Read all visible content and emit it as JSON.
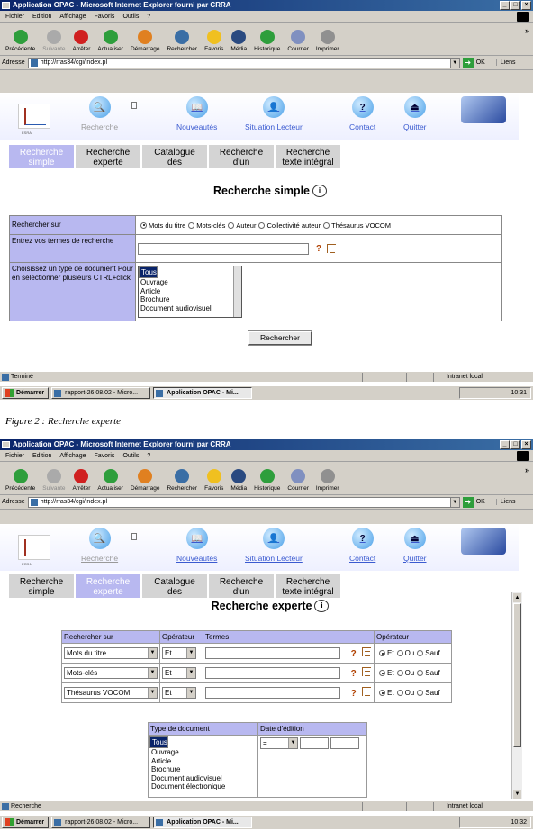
{
  "window": {
    "title": "Application OPAC - Microsoft Internet Explorer fourni par CRRA",
    "menu": [
      "Fichier",
      "Edition",
      "Affichage",
      "Favoris",
      "Outils",
      "?"
    ],
    "toolbar": [
      {
        "label": "Précédente",
        "icon": "back-icon",
        "color": "#2e9e3c"
      },
      {
        "label": "Suivante",
        "icon": "forward-icon",
        "color": "#aaaaaa"
      },
      {
        "label": "Arrêter",
        "icon": "stop-icon",
        "color": "#d02020"
      },
      {
        "label": "Actualiser",
        "icon": "refresh-icon",
        "color": "#2e9e3c"
      },
      {
        "label": "Démarrage",
        "icon": "home-icon",
        "color": "#e08020"
      },
      {
        "label": "Rechercher",
        "icon": "search-icon",
        "color": "#3a6ea5"
      },
      {
        "label": "Favoris",
        "icon": "star-icon",
        "color": "#f0c020"
      },
      {
        "label": "Média",
        "icon": "media-icon",
        "color": "#2a4a80"
      },
      {
        "label": "Historique",
        "icon": "history-icon",
        "color": "#2e9e3c"
      },
      {
        "label": "Courrier",
        "icon": "mail-icon",
        "color": "#8090c0"
      },
      {
        "label": "Imprimer",
        "icon": "print-icon",
        "color": "#909090"
      }
    ],
    "address_label": "Adresse",
    "url": "http://rras34/cgi/index.pl",
    "go": "OK",
    "links": "Liens",
    "chevron": "»"
  },
  "banner": {
    "logo_text": "ESRA",
    "items": [
      {
        "label": "Recherche",
        "icon": "magnifier-icon",
        "glyph": "🔍",
        "grey": true
      },
      {
        "label": "Nouveautés",
        "icon": "newbook-icon",
        "glyph": "📖",
        "grey": false
      },
      {
        "label": "Situation Lecteur",
        "icon": "reader-icon",
        "glyph": "👤",
        "grey": false
      },
      {
        "label": "Contact",
        "icon": "contact-icon",
        "glyph": "?",
        "grey": false
      },
      {
        "label": "Quitter",
        "icon": "exit-icon",
        "glyph": "⏏",
        "grey": false
      }
    ]
  },
  "tabs": [
    {
      "line1": "Recherche",
      "line2": "simple"
    },
    {
      "line1": "Recherche",
      "line2": "experte"
    },
    {
      "line1": "Catalogue",
      "line2": "des"
    },
    {
      "line1": "Recherche",
      "line2": "d'un"
    },
    {
      "line1": "Recherche",
      "line2": "texte intégral"
    }
  ],
  "simple": {
    "heading": "Recherche simple",
    "row1_label": "Rechercher sur",
    "radios": [
      "Mots du titre",
      "Mots-clés",
      "Auteur",
      "Collectivité auteur",
      "Thésaurus VOCOM"
    ],
    "row2_label": "Entrez vos termes de recherche",
    "row3_label": "Choisissez un type de document Pour en sélectionner plusieurs CTRL+click",
    "doc_types": [
      "Tous",
      "Ouvrage",
      "Article",
      "Brochure",
      "Document audiovisuel"
    ],
    "submit": "Rechercher"
  },
  "status1": {
    "text": "Terminé",
    "zone": "Intranet local"
  },
  "taskbar1": {
    "start": "Démarrer",
    "tasks": [
      "rapport-26.08.02 - Micro...",
      "Application OPAC - Mi..."
    ],
    "time": "10:31"
  },
  "caption": "Figure 2 : Recherche experte",
  "expert": {
    "heading": "Recherche experte",
    "headers": [
      "Rechercher sur",
      "Opérateur",
      "Termes",
      "",
      "Opérateur"
    ],
    "rows": [
      {
        "field": "Mots du titre",
        "op": "Et"
      },
      {
        "field": "Mots-clés",
        "op": "Et"
      },
      {
        "field": "Thésaurus VOCOM",
        "op": "Et"
      }
    ],
    "bool_ops": [
      "Et",
      "Ou",
      "Sauf"
    ],
    "doc_header": "Type de document",
    "date_header": "Date d'édition",
    "date_op": "=",
    "doc_types": [
      "Tous",
      "Ouvrage",
      "Article",
      "Brochure",
      "Document audiovisuel",
      "Document électronique"
    ]
  },
  "status2": {
    "text": "Recherche",
    "zone": "Intranet local"
  },
  "taskbar2": {
    "start": "Démarrer",
    "tasks": [
      "rapport-26.08.02 - Micro...",
      "Application OPAC - Mi..."
    ],
    "time": "10:32"
  },
  "qmark": "?"
}
